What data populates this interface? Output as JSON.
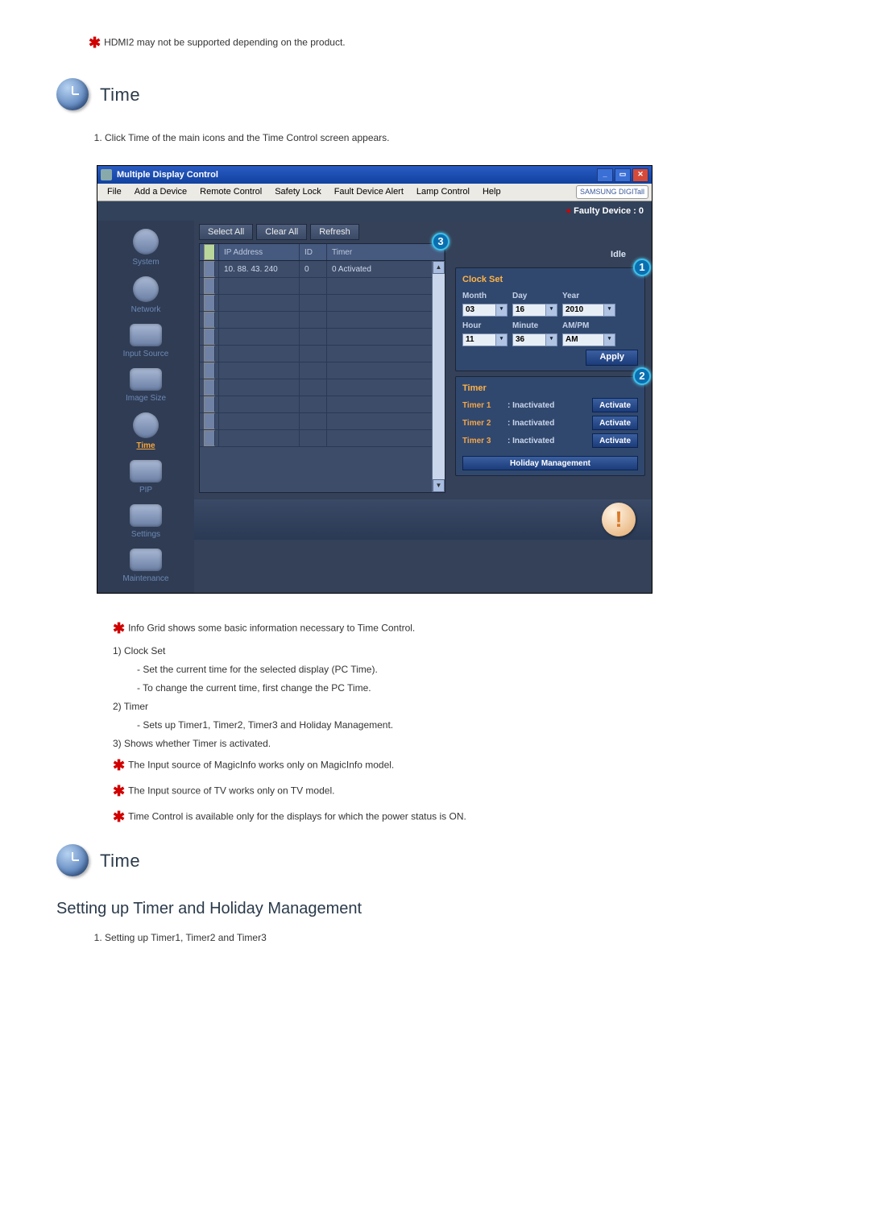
{
  "top_note": "HDMI2 may not be supported depending on the product.",
  "section1_title": "Time",
  "intro_item": "Click Time of the main icons and the Time Control screen appears.",
  "app": {
    "title": "Multiple Display Control",
    "menus": [
      "File",
      "Add a Device",
      "Remote Control",
      "Safety Lock",
      "Fault Device Alert",
      "Lamp Control",
      "Help"
    ],
    "brand": "SAMSUNG DIGITall",
    "faulty": "Faulty Device : 0",
    "toolbar": {
      "select_all": "Select All",
      "clear_all": "Clear All",
      "refresh": "Refresh",
      "idle": "Idle"
    },
    "columns": {
      "ip": "IP Address",
      "id": "ID",
      "timer": "Timer"
    },
    "row": {
      "ip": "10. 88. 43. 240",
      "id": "0",
      "timer": "0 Activated"
    },
    "sidebar": [
      {
        "label": "System"
      },
      {
        "label": "Network"
      },
      {
        "label": "Input Source"
      },
      {
        "label": "Image Size"
      },
      {
        "label": "Time",
        "active": true
      },
      {
        "label": "PIP"
      },
      {
        "label": "Settings"
      },
      {
        "label": "Maintenance"
      }
    ],
    "clock": {
      "title": "Clock Set",
      "month_label": "Month",
      "month_val": "03",
      "day_label": "Day",
      "day_val": "16",
      "year_label": "Year",
      "year_val": "2010",
      "hour_label": "Hour",
      "hour_val": "11",
      "minute_label": "Minute",
      "minute_val": "36",
      "ampm_label": "AM/PM",
      "ampm_val": "AM",
      "apply": "Apply"
    },
    "timer": {
      "title": "Timer",
      "rows": [
        {
          "name": "Timer 1",
          "status": ": Inactivated",
          "btn": "Activate"
        },
        {
          "name": "Timer 2",
          "status": ": Inactivated",
          "btn": "Activate"
        },
        {
          "name": "Timer 3",
          "status": ": Inactivated",
          "btn": "Activate"
        }
      ],
      "holiday": "Holiday Management"
    },
    "callouts": {
      "c1": "1",
      "c2": "2",
      "c3": "3"
    }
  },
  "desc": {
    "l1": "Info Grid shows some basic information necessary to Time Control.",
    "l2": "1) Clock Set",
    "l3": "- Set the current time for the selected display (PC Time).",
    "l4": "- To change the current time, first change the PC Time.",
    "l5": "2) Timer",
    "l6": "- Sets up Timer1, Timer2, Timer3 and Holiday Management.",
    "l7": "3) Shows whether Timer is activated.",
    "l8": "The Input source of MagicInfo works only on MagicInfo model.",
    "l9": "The Input source of TV works only on TV model.",
    "l10": "Time Control is available only for the displays for which the power status is ON."
  },
  "section2_title": "Time",
  "subtitle": "Setting up Timer and Holiday Management",
  "sub_item": "Setting up Timer1, Timer2 and Timer3"
}
